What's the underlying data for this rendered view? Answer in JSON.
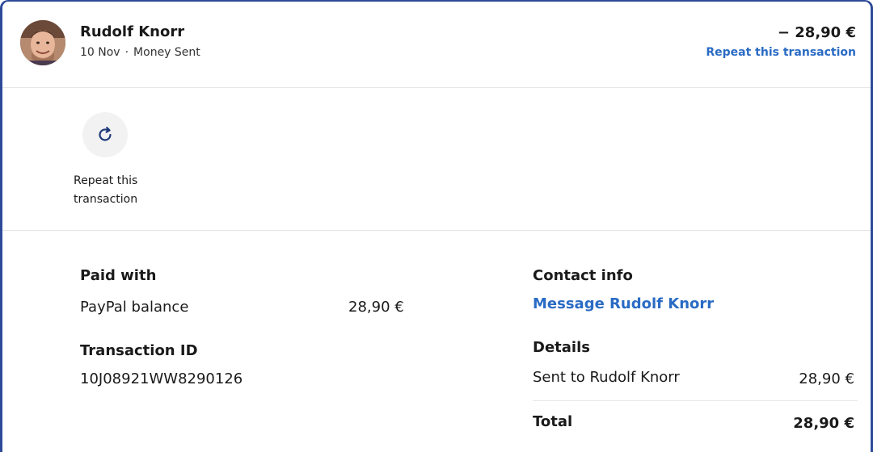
{
  "header": {
    "name": "Rudolf Knorr",
    "date": "10 Nov",
    "separator": "·",
    "type": "Money Sent",
    "amount": "− 28,90 €",
    "repeat_link": "Repeat this transaction"
  },
  "actions": {
    "repeat_line1": "Repeat this",
    "repeat_line2": "transaction"
  },
  "paid_with": {
    "heading": "Paid with",
    "method": "PayPal balance",
    "amount": "28,90 €"
  },
  "transaction": {
    "heading": "Transaction ID",
    "id": "10J08921WW8290126"
  },
  "contact": {
    "heading": "Contact info",
    "message_link": "Message Rudolf Knorr"
  },
  "details": {
    "heading": "Details",
    "sent_to_label": "Sent to Rudolf Knorr",
    "sent_to_amount": "28,90 €",
    "total_label": "Total",
    "total_amount": "28,90 €"
  },
  "colors": {
    "accent_link": "#2a6bc4",
    "frame_border": "#2d4a9a",
    "icon": "#1f3a7a"
  }
}
